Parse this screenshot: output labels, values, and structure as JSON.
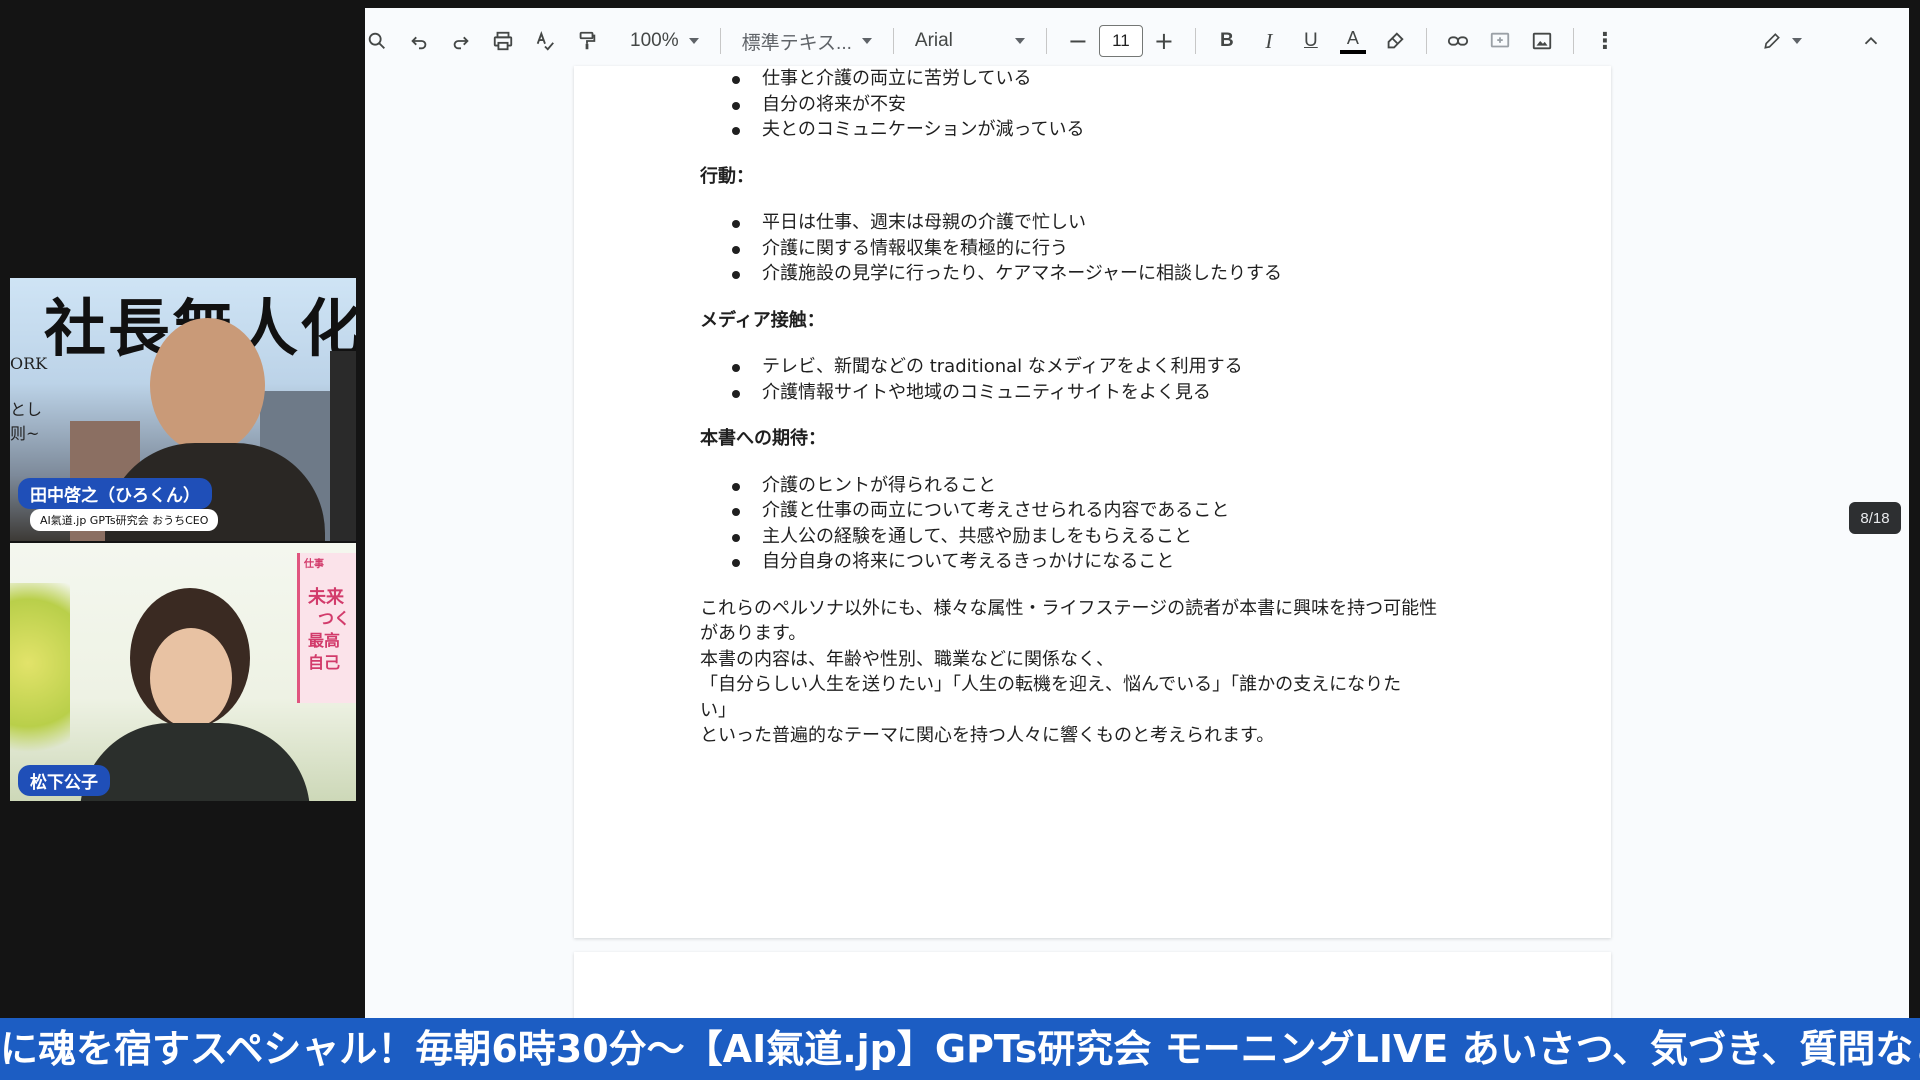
{
  "toolbar": {
    "zoom": "100%",
    "style": "標準テキス...",
    "font": "Arial",
    "font_size": "11",
    "bold": "B",
    "italic": "I",
    "underline": "U",
    "text_color": "A"
  },
  "document": {
    "bullets_top": [
      "仕事と介護の両立に苦労している",
      "自分の将来が不安",
      "夫とのコミュニケーションが減っている"
    ],
    "section_action": {
      "heading": "行動：",
      "items": [
        "平日は仕事、週末は母親の介護で忙しい",
        "介護に関する情報収集を積極的に行う",
        "介護施設の見学に行ったり、ケアマネージャーに相談したりする"
      ]
    },
    "section_media": {
      "heading": "メディア接触：",
      "items": [
        "テレビ、新聞などの traditional なメディアをよく利用する",
        "介護情報サイトや地域のコミュニティサイトをよく見る"
      ]
    },
    "section_expect": {
      "heading": "本書への期待：",
      "items": [
        "介護のヒントが得られること",
        "介護と仕事の両立について考えさせられる内容であること",
        "主人公の経験を通して、共感や励ましをもらえること",
        "自分自身の将来について考えるきっかけになること"
      ]
    },
    "closing_lines": [
      "これらのペルソナ以外にも、様々な属性・ライフステージの読者が本書に興味を持つ可能性",
      "があります。",
      "本書の内容は、年齢や性別、職業などに関係なく、",
      "「自分らしい人生を送りたい」「人生の転機を迎え、悩んでいる」「誰かの支えになりた",
      "い」",
      "といった普遍的なテーマに関心を持つ人々に響くものと考えられます。"
    ]
  },
  "page_indicator": "8/18",
  "participants": {
    "host": {
      "name": "田中啓之（ひろくん）",
      "title": "AI氣道.jp GPTs研究会 おうちCEO",
      "background_text": "社長無人化",
      "background_side": [
        "ORK",
        "とし",
        "则~"
      ]
    },
    "guest": {
      "name": "松下公子",
      "book_text": [
        "仕事",
        "未来",
        "つく",
        "最高",
        "自己"
      ]
    }
  },
  "ticker_text": "に魂を宿すスペシャル！毎朝6時30分〜【AI氣道.jp】GPTs研究会 モーニングLIVE あいさつ、気づき、質問など"
}
